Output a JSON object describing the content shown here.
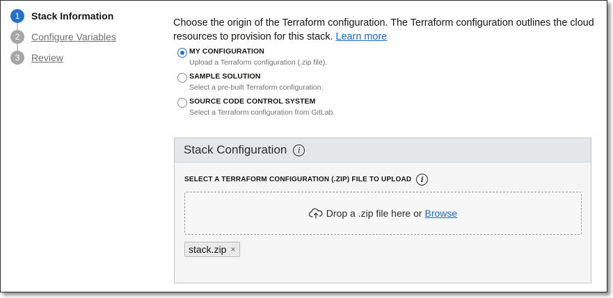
{
  "steps": [
    {
      "number": "1",
      "label": "Stack Information",
      "active": true
    },
    {
      "number": "2",
      "label": "Configure Variables",
      "active": false
    },
    {
      "number": "3",
      "label": "Review",
      "active": false
    }
  ],
  "intro": {
    "text": "Choose the origin of the Terraform configuration. The Terraform configuration outlines the cloud resources to provision for this stack.",
    "link": "Learn more"
  },
  "origin_options": [
    {
      "title": "MY CONFIGURATION",
      "description": "Upload a Terraform configuration (.zip file).",
      "selected": true
    },
    {
      "title": "SAMPLE SOLUTION",
      "description": "Select a pre-built Terraform configuration.",
      "selected": false
    },
    {
      "title": "SOURCE CODE CONTROL SYSTEM",
      "description": "Select a Terraform configuration from GitLab.",
      "selected": false
    }
  ],
  "panel": {
    "title": "Stack Configuration",
    "upload_label": "SELECT A TERRAFORM CONFIGURATION (.ZIP) FILE TO UPLOAD",
    "dropzone_text": "Drop a .zip file here or",
    "browse_link": "Browse",
    "file_name": "stack.zip",
    "remove_glyph": "×"
  },
  "icons": {
    "info": "i",
    "upload": "cloud-upload-icon"
  },
  "colors": {
    "accent": "#2672c6",
    "link": "#1f66b8",
    "panel_header": "#e4e7ea"
  }
}
